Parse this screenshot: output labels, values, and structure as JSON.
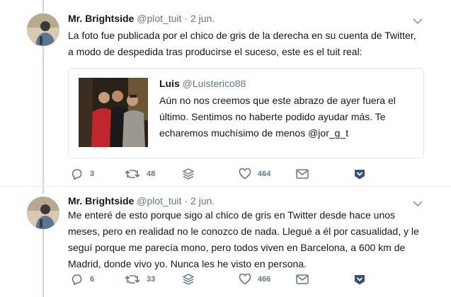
{
  "tweets": [
    {
      "author_name": "Mr. Brightside",
      "handle": "@plot_tuit",
      "separator": "·",
      "date": "2 jun.",
      "lines": [
        "La foto fue publicada por el chico de gris de la derecha en su cuenta de Twitter,",
        "a modo de despedida tras producirse el suceso, este es el tuit real:"
      ],
      "quote": {
        "author_name": "Luis",
        "handle": "@Luisterico88",
        "lines": [
          "Aún no nos creemos que este abrazo de ayer fuera el",
          "último. Sentimos no haberte podido ayudar más. Te",
          "echaremos muchísimo de menos @jor_g_t"
        ]
      },
      "replies": "3",
      "retweets": "48",
      "likes": "464"
    },
    {
      "author_name": "Mr. Brightside",
      "handle": "@plot_tuit",
      "separator": "·",
      "date": "2 jun.",
      "lines": [
        "Me enteré de esto porque sigo al chico de gris en Twitter desde hace unos",
        "meses, pero en realidad no le conozco de nada. Llegué a él por casualidad, y le",
        "seguí porque me parecía mono, pero todos viven en Barcelona, a 600 km de",
        "Madrid, donde vivo yo. Nunca les he visto en persona."
      ],
      "replies": "6",
      "retweets": "33",
      "likes": "466"
    }
  ],
  "icons": {
    "reply": "reply-icon",
    "retweet": "retweet-icon",
    "stack": "stack-icon",
    "like": "heart-icon",
    "message": "envelope-icon",
    "save": "bookmark-shield-icon",
    "menu": "chevron-down-icon"
  },
  "colors": {
    "text": "#14171a",
    "muted": "#657786",
    "border": "#e1e8ed",
    "thread": "#ccd6dd",
    "save_icon": "#3b5177"
  }
}
